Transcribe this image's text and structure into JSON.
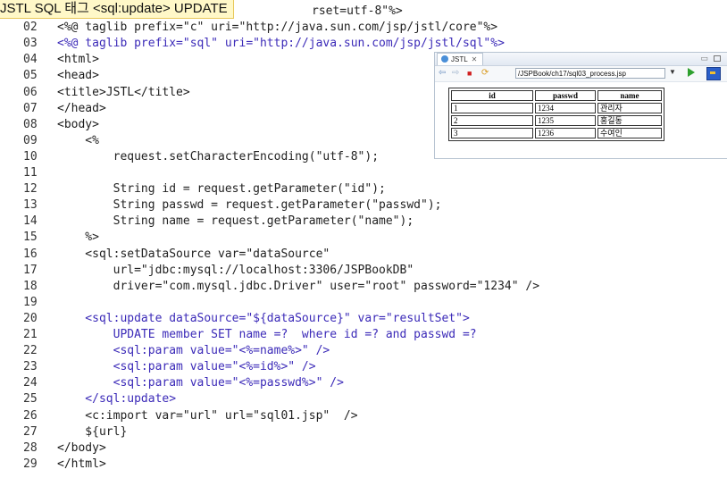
{
  "slide_title": "JSTL SQL 태그 <sql:update> UPDATE",
  "code_lines": [
    {
      "num": "01",
      "segments": [
        {
          "t": "rset=utf-8\"%>",
          "c": "c-text"
        }
      ]
    },
    {
      "num": "02",
      "segments": [
        {
          "t": "<%@ taglib prefix=\"c\" uri=\"http://java.sun.com/jsp/jstl/core\"%>",
          "c": "c-text"
        }
      ]
    },
    {
      "num": "03",
      "segments": [
        {
          "t": "<%@ taglib prefix=\"sql\" uri=\"http://java.sun.com/jsp/jstl/sql\"%>",
          "c": "c-sql"
        }
      ]
    },
    {
      "num": "04",
      "segments": [
        {
          "t": "<html>",
          "c": "c-tag"
        }
      ]
    },
    {
      "num": "05",
      "segments": [
        {
          "t": "<head>",
          "c": "c-tag"
        }
      ]
    },
    {
      "num": "06",
      "segments": [
        {
          "t": "<title>JSTL</title>",
          "c": "c-tag"
        }
      ]
    },
    {
      "num": "07",
      "segments": [
        {
          "t": "</head>",
          "c": "c-tag"
        }
      ]
    },
    {
      "num": "08",
      "segments": [
        {
          "t": "<body>",
          "c": "c-tag"
        }
      ]
    },
    {
      "num": "09",
      "segments": [
        {
          "t": "    <%",
          "c": "c-text"
        }
      ]
    },
    {
      "num": "10",
      "segments": [
        {
          "t": "        request.setCharacterEncoding(\"utf-8\");",
          "c": "c-text"
        }
      ]
    },
    {
      "num": "11",
      "segments": [
        {
          "t": "",
          "c": "c-text"
        }
      ]
    },
    {
      "num": "12",
      "segments": [
        {
          "t": "        String id = request.getParameter(\"id\");",
          "c": "c-text"
        }
      ]
    },
    {
      "num": "13",
      "segments": [
        {
          "t": "        String passwd = request.getParameter(\"passwd\");",
          "c": "c-text"
        }
      ]
    },
    {
      "num": "14",
      "segments": [
        {
          "t": "        String name = request.getParameter(\"name\");",
          "c": "c-text"
        }
      ]
    },
    {
      "num": "15",
      "segments": [
        {
          "t": "    %>",
          "c": "c-text"
        }
      ]
    },
    {
      "num": "16",
      "segments": [
        {
          "t": "    <sql:setDataSource var=\"dataSource\"",
          "c": "c-text"
        }
      ]
    },
    {
      "num": "17",
      "segments": [
        {
          "t": "        url=\"jdbc:mysql://localhost:3306/JSPBookDB\"",
          "c": "c-text"
        }
      ]
    },
    {
      "num": "18",
      "segments": [
        {
          "t": "        driver=\"com.mysql.jdbc.Driver\" user=\"root\" password=\"1234\" />",
          "c": "c-text"
        }
      ]
    },
    {
      "num": "19",
      "segments": [
        {
          "t": "",
          "c": "c-text"
        }
      ]
    },
    {
      "num": "20",
      "segments": [
        {
          "t": "    <sql:update dataSource=\"${dataSource}\" var=\"resultSet\">",
          "c": "c-sql"
        }
      ]
    },
    {
      "num": "21",
      "segments": [
        {
          "t": "        UPDATE member SET name =?  where id =? and passwd =?",
          "c": "c-sql"
        }
      ]
    },
    {
      "num": "22",
      "segments": [
        {
          "t": "        <sql:param value=\"<%=name%>\" />",
          "c": "c-sql"
        }
      ]
    },
    {
      "num": "23",
      "segments": [
        {
          "t": "        <sql:param value=\"<%=id%>\" />",
          "c": "c-sql"
        }
      ]
    },
    {
      "num": "24",
      "segments": [
        {
          "t": "        <sql:param value=\"<%=passwd%>\" />",
          "c": "c-sql"
        }
      ]
    },
    {
      "num": "25",
      "segments": [
        {
          "t": "    </sql:update>",
          "c": "c-sql"
        }
      ]
    },
    {
      "num": "26",
      "segments": [
        {
          "t": "    <c:import var=\"url\" url=\"sql01.jsp\"  />",
          "c": "c-text"
        }
      ]
    },
    {
      "num": "27",
      "segments": [
        {
          "t": "    ${url}",
          "c": "c-text"
        }
      ]
    },
    {
      "num": "28",
      "segments": [
        {
          "t": "</body>",
          "c": "c-tag"
        }
      ]
    },
    {
      "num": "29",
      "segments": [
        {
          "t": "</html>",
          "c": "c-tag"
        }
      ]
    }
  ],
  "browser": {
    "tab_label": "JSTL",
    "tab_close": "✕",
    "url": "/JSPBook/ch17/sql03_process.jsp",
    "table": {
      "headers": [
        "id",
        "passwd",
        "name"
      ],
      "rows": [
        [
          "1",
          "1234",
          "관리자"
        ],
        [
          "2",
          "1235",
          "홍길동"
        ],
        [
          "3",
          "1236",
          "수여인"
        ]
      ]
    }
  }
}
